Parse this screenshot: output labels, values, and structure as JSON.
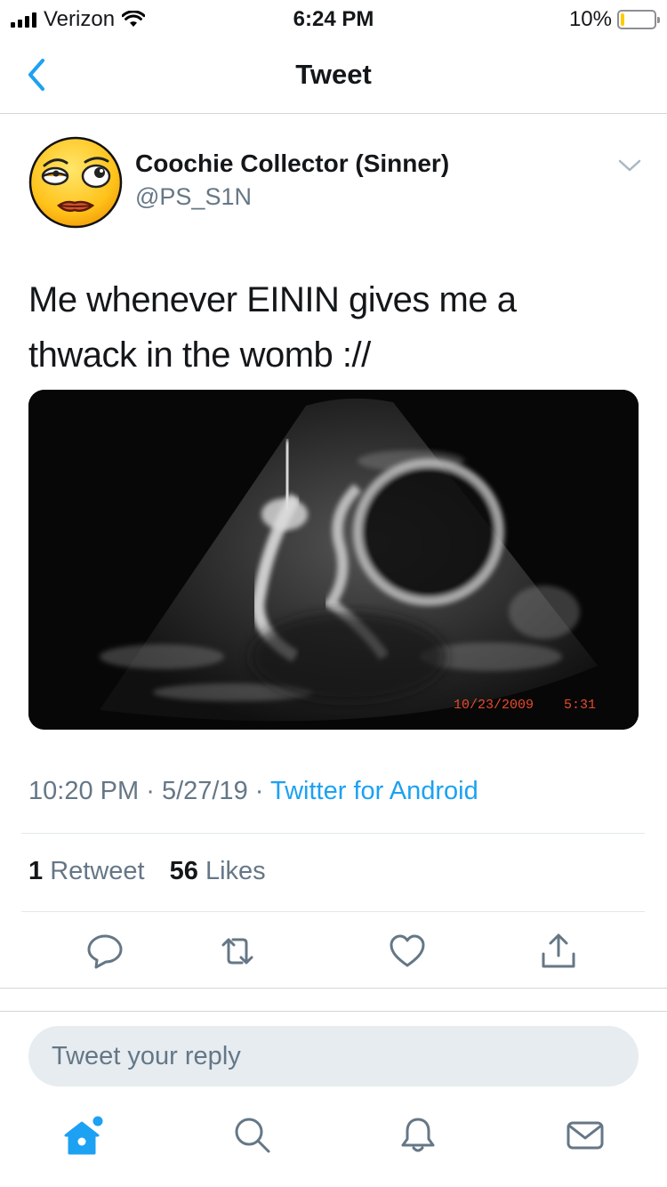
{
  "status_bar": {
    "carrier": "Verizon",
    "time": "6:24 PM",
    "battery_percent": "10%",
    "battery_level": 0.1,
    "battery_color": "#ffcc00"
  },
  "nav": {
    "title": "Tweet",
    "back_icon": "chevron-left-icon"
  },
  "tweet": {
    "author_name": "Coochie Collector (Sinner)",
    "author_handle": "@PS_S1N",
    "avatar_icon": "rolling-eyes-emoji",
    "text_lines": [
      "Me whenever EININ gives me a",
      "thwack in the womb ://"
    ],
    "media": {
      "kind": "ultrasound-image",
      "overlay_date": "10/23/2009",
      "overlay_time": "5:31"
    },
    "time": "10:20 PM",
    "date": "5/27/19",
    "source": "Twitter for Android",
    "separator": "·",
    "retweet_count": "1",
    "retweet_label": "Retweet",
    "like_count": "56",
    "like_label": "Likes"
  },
  "actions": [
    "reply-icon",
    "retweet-icon",
    "like-icon",
    "share-icon"
  ],
  "reply": {
    "placeholder": "Tweet your reply"
  },
  "tab_bar": [
    "home-icon",
    "search-icon",
    "notifications-icon",
    "messages-icon"
  ],
  "colors": {
    "accent": "#1da1f2",
    "secondary_text": "#657786",
    "action_icons": "#657786"
  }
}
